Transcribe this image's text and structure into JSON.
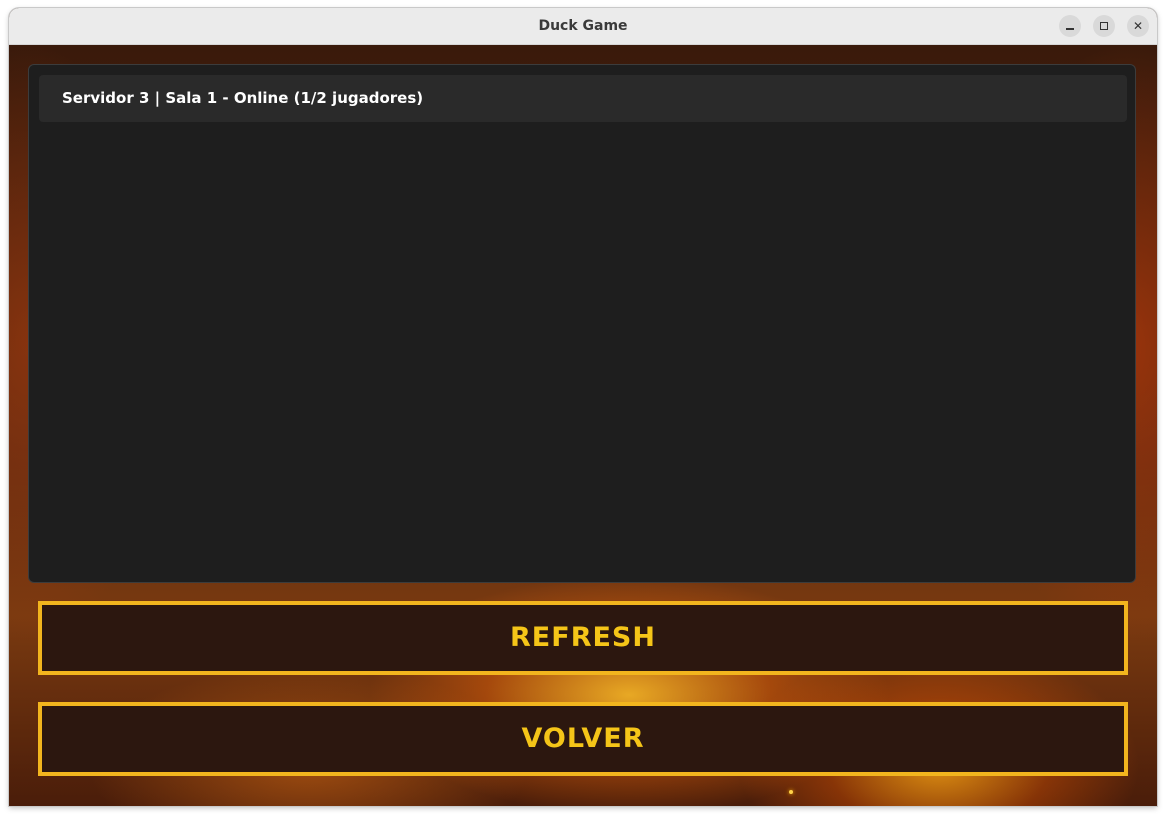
{
  "window": {
    "title": "Duck Game",
    "controls": {
      "minimize_icon": "minimize-icon",
      "maximize_icon": "maximize-icon",
      "close_icon": "close-icon",
      "close_glyph": "✕"
    }
  },
  "rooms": {
    "items": [
      {
        "label": "Servidor 3 | Sala 1 - Online (1/2 jugadores)"
      }
    ]
  },
  "actions": {
    "refresh_label": "REFRESH",
    "volver_label": "VOLVER"
  },
  "colors": {
    "accent_border": "#f2b51e",
    "button_text": "#f5c518",
    "button_bg": "#2c170f",
    "panel_bg": "#1e1e1e",
    "item_bg": "#2a2a2a"
  }
}
